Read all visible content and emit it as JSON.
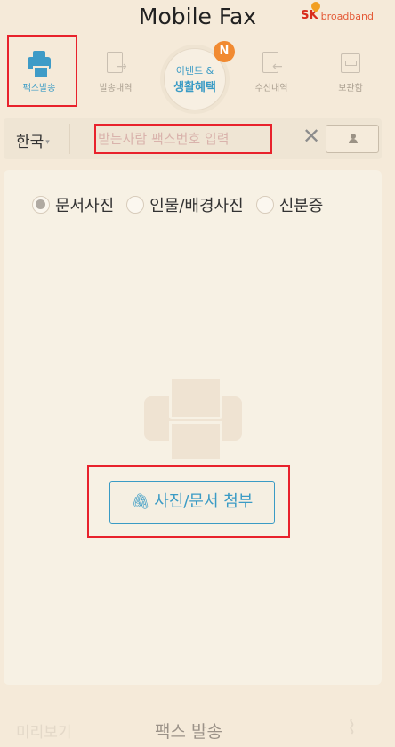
{
  "header": {
    "title": "Mobile Fax",
    "brand_sk": "SK",
    "brand_name": "broadband"
  },
  "nav": {
    "items": [
      {
        "label": "팩스발송",
        "icon": "printer-icon",
        "active": true
      },
      {
        "label": "발송내역",
        "icon": "sent-history-icon",
        "active": false
      },
      {
        "label": "수신내역",
        "icon": "received-history-icon",
        "active": false
      },
      {
        "label": "보관함",
        "icon": "archive-icon",
        "active": false
      }
    ],
    "event": {
      "line1": "이벤트 &",
      "line2": "생활혜택",
      "badge": "N"
    }
  },
  "fax_input": {
    "country": "한국",
    "placeholder": "받는사람 팩스번호 입력",
    "clear_icon": "close-icon",
    "contact_icon": "contact-icon"
  },
  "doc_type_options": [
    {
      "label": "문서사진",
      "selected": true
    },
    {
      "label": "인물/배경사진",
      "selected": false
    },
    {
      "label": "신분증",
      "selected": false
    }
  ],
  "attach_button": {
    "label": "사진/문서 첨부",
    "icon": "paperclip-icon"
  },
  "bottom_bar": {
    "preview_label": "미리보기",
    "send_label": "팩스 발송",
    "attach_icon": "paperclip-icon"
  },
  "colors": {
    "accent": "#3a9bc5",
    "background": "#f5ead9",
    "highlight": "#e8222c",
    "badge": "#f18a31"
  }
}
